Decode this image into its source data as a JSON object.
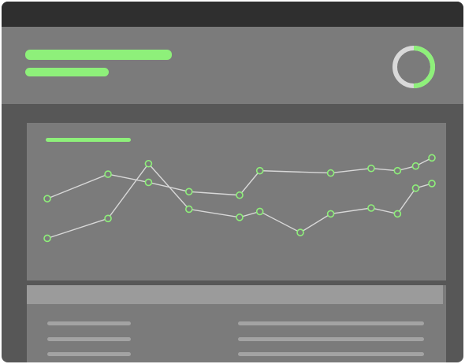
{
  "colors": {
    "accent": "#8ef07a",
    "titlebar": "#2f2f2f",
    "window_bg": "#575757",
    "panel": "#7b7b7b",
    "table_header": "#9b9b9b",
    "placeholder_line": "#a3a3a3",
    "series_line": "#d8d8d8",
    "ring_track": "#d9d9d9"
  },
  "header": {
    "title_placeholder": "",
    "subtitle_placeholder": ""
  },
  "progress_ring": {
    "value": 0.5
  },
  "chart_data": {
    "type": "line",
    "title": "",
    "xlabel": "",
    "ylabel": "",
    "grid": false,
    "legend": "none",
    "xlim": [
      0,
      16
    ],
    "ylim": [
      0,
      100
    ],
    "series": [
      {
        "x": [
          0,
          3,
          5,
          7,
          9.5,
          10.5,
          14,
          16,
          17.3,
          18.2,
          19
        ],
        "values": [
          58,
          79,
          72,
          64,
          61,
          82,
          80,
          84,
          82,
          86,
          93
        ]
      },
      {
        "x": [
          0,
          3,
          5,
          7,
          9.5,
          10.5,
          12.5,
          14,
          16,
          17.3,
          18.2,
          19
        ],
        "values": [
          24,
          41,
          88,
          49,
          42,
          47,
          29,
          45,
          50,
          45,
          67,
          71
        ]
      }
    ]
  },
  "table": {
    "rows": [
      {
        "left": "",
        "right": ""
      },
      {
        "left": "",
        "right": ""
      },
      {
        "left": "",
        "right": ""
      }
    ]
  }
}
